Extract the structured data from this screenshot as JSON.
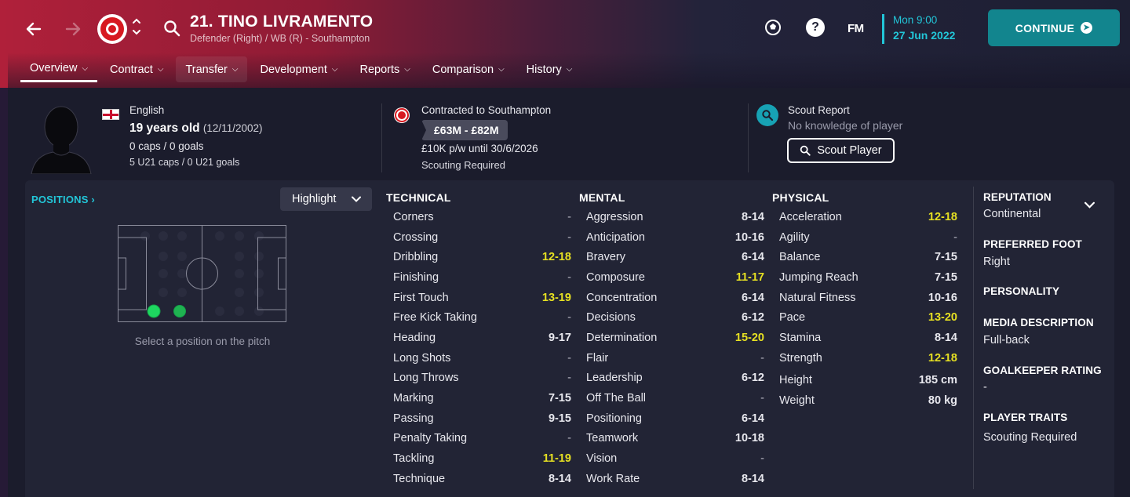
{
  "header": {
    "player_title": "21. TINO LIVRAMENTO",
    "player_subtitle": "Defender (Right) / WB (R) - Southampton",
    "fm_logo": "FM",
    "date_time": "Mon 9:00",
    "date_date": "27 Jun 2022",
    "continue_label": "CONTINUE",
    "icons": [
      "back-arrow-icon",
      "forward-arrow-icon",
      "club-badge",
      "search-icon",
      "football-icon",
      "help-icon"
    ],
    "accent_color": "#22c6d8",
    "continue_color": "#12858e"
  },
  "tabs": [
    {
      "label": "Overview"
    },
    {
      "label": "Contract"
    },
    {
      "label": "Transfer"
    },
    {
      "label": "Development"
    },
    {
      "label": "Reports"
    },
    {
      "label": "Comparison"
    },
    {
      "label": "History"
    }
  ],
  "profile": {
    "nationality": "English",
    "age": "19 years old",
    "dob": "(12/11/2002)",
    "caps": "0 caps / 0 goals",
    "u21": "5 U21 caps / 0 U21 goals"
  },
  "contract": {
    "title": "Contracted to Southampton",
    "value": "£63M - £82M",
    "wage": "£10K p/w until 30/6/2026",
    "scouting": "Scouting Required"
  },
  "scout": {
    "title": "Scout Report",
    "knowledge": "No knowledge of player",
    "button": "Scout Player"
  },
  "positions": {
    "label": "POSITIONS",
    "highlight": "Highlight",
    "caption": "Select a position on the pitch"
  },
  "technical": {
    "heading": "TECHNICAL",
    "rows": [
      {
        "name": "Corners",
        "value": "-"
      },
      {
        "name": "Crossing",
        "value": "-"
      },
      {
        "name": "Dribbling",
        "value": "12-18",
        "hi": true
      },
      {
        "name": "Finishing",
        "value": "-"
      },
      {
        "name": "First Touch",
        "value": "13-19",
        "hi": true
      },
      {
        "name": "Free Kick Taking",
        "value": "-"
      },
      {
        "name": "Heading",
        "value": "9-17"
      },
      {
        "name": "Long Shots",
        "value": "-"
      },
      {
        "name": "Long Throws",
        "value": "-"
      },
      {
        "name": "Marking",
        "value": "7-15"
      },
      {
        "name": "Passing",
        "value": "9-15"
      },
      {
        "name": "Penalty Taking",
        "value": "-"
      },
      {
        "name": "Tackling",
        "value": "11-19",
        "hi": true
      },
      {
        "name": "Technique",
        "value": "8-14"
      }
    ]
  },
  "mental": {
    "heading": "MENTAL",
    "rows": [
      {
        "name": "Aggression",
        "value": "8-14"
      },
      {
        "name": "Anticipation",
        "value": "10-16"
      },
      {
        "name": "Bravery",
        "value": "6-14"
      },
      {
        "name": "Composure",
        "value": "11-17",
        "hi": true
      },
      {
        "name": "Concentration",
        "value": "6-14"
      },
      {
        "name": "Decisions",
        "value": "6-12"
      },
      {
        "name": "Determination",
        "value": "15-20",
        "hi": true
      },
      {
        "name": "Flair",
        "value": "-"
      },
      {
        "name": "Leadership",
        "value": "6-12"
      },
      {
        "name": "Off The Ball",
        "value": "-"
      },
      {
        "name": "Positioning",
        "value": "6-14"
      },
      {
        "name": "Teamwork",
        "value": "10-18"
      },
      {
        "name": "Vision",
        "value": "-"
      },
      {
        "name": "Work Rate",
        "value": "8-14"
      }
    ]
  },
  "physical": {
    "heading": "PHYSICAL",
    "rows": [
      {
        "name": "Acceleration",
        "value": "12-18",
        "hi": true
      },
      {
        "name": "Agility",
        "value": "-"
      },
      {
        "name": "Balance",
        "value": "7-15"
      },
      {
        "name": "Jumping Reach",
        "value": "7-15"
      },
      {
        "name": "Natural Fitness",
        "value": "10-16"
      },
      {
        "name": "Pace",
        "value": "13-20",
        "hi": true
      },
      {
        "name": "Stamina",
        "value": "8-14"
      },
      {
        "name": "Strength",
        "value": "12-18",
        "hi": true
      },
      {
        "name": "Height",
        "value": "185 cm"
      },
      {
        "name": "Weight",
        "value": "80 kg"
      }
    ]
  },
  "side": {
    "reputation_label": "REPUTATION",
    "reputation_value": "Continental",
    "foot_label": "PREFERRED FOOT",
    "foot_value": "Right",
    "personality_label": "PERSONALITY",
    "media_label": "MEDIA DESCRIPTION",
    "media_value": "Full-back",
    "gk_label": "GOALKEEPER RATING",
    "gk_value": "-",
    "traits_label": "PLAYER TRAITS",
    "traits_value": "Scouting Required"
  }
}
